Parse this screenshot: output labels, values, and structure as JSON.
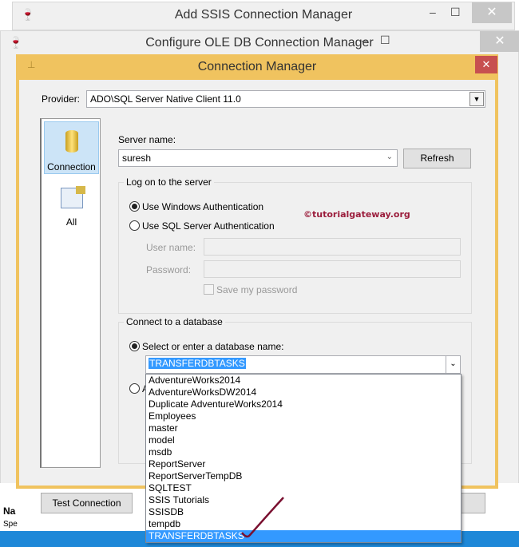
{
  "windows": {
    "add_ssis": {
      "title": "Add SSIS Connection Manager"
    },
    "configure_oledb": {
      "title": "Configure OLE DB Connection Manager"
    },
    "connection_manager": {
      "title": "Connection Manager"
    }
  },
  "provider": {
    "label": "Provider:",
    "value": "ADO\\SQL Server Native Client 11.0"
  },
  "sidebar": {
    "items": [
      {
        "label": "Connection"
      },
      {
        "label": "All"
      }
    ]
  },
  "server": {
    "label": "Server name:",
    "value": "suresh",
    "refresh": "Refresh"
  },
  "logon": {
    "legend": "Log on to the server",
    "windows_auth": "Use Windows Authentication",
    "sql_auth": "Use SQL Server Authentication",
    "user_label": "User name:",
    "password_label": "Password:",
    "save_password": "Save my password"
  },
  "watermark": "©tutorialgateway.org",
  "database": {
    "legend": "Connect to a database",
    "select_label": "Select or enter a database name:",
    "value": "TRANSFERDBTASKS",
    "attach_partial": "A",
    "options": [
      "AdventureWorks2014",
      "AdventureWorksDW2014",
      "Duplicate AdventureWorks2014",
      "Employees",
      "master",
      "model",
      "msdb",
      "ReportServer",
      "ReportServerTempDB",
      "SQLTEST",
      "SSIS Tutorials",
      "SSISDB",
      "tempdb",
      "TRANSFERDBTASKS"
    ],
    "selected_index": 13
  },
  "buttons": {
    "test_connection": "Test Connection"
  },
  "background": {
    "text1": "Na",
    "text2": "Spe"
  },
  "colors": {
    "title_yellow": "#f0c35f",
    "close_red": "#c75050",
    "selection": "#3399ff",
    "taskbar": "#1e88d8",
    "watermark": "#9b1d3c"
  }
}
